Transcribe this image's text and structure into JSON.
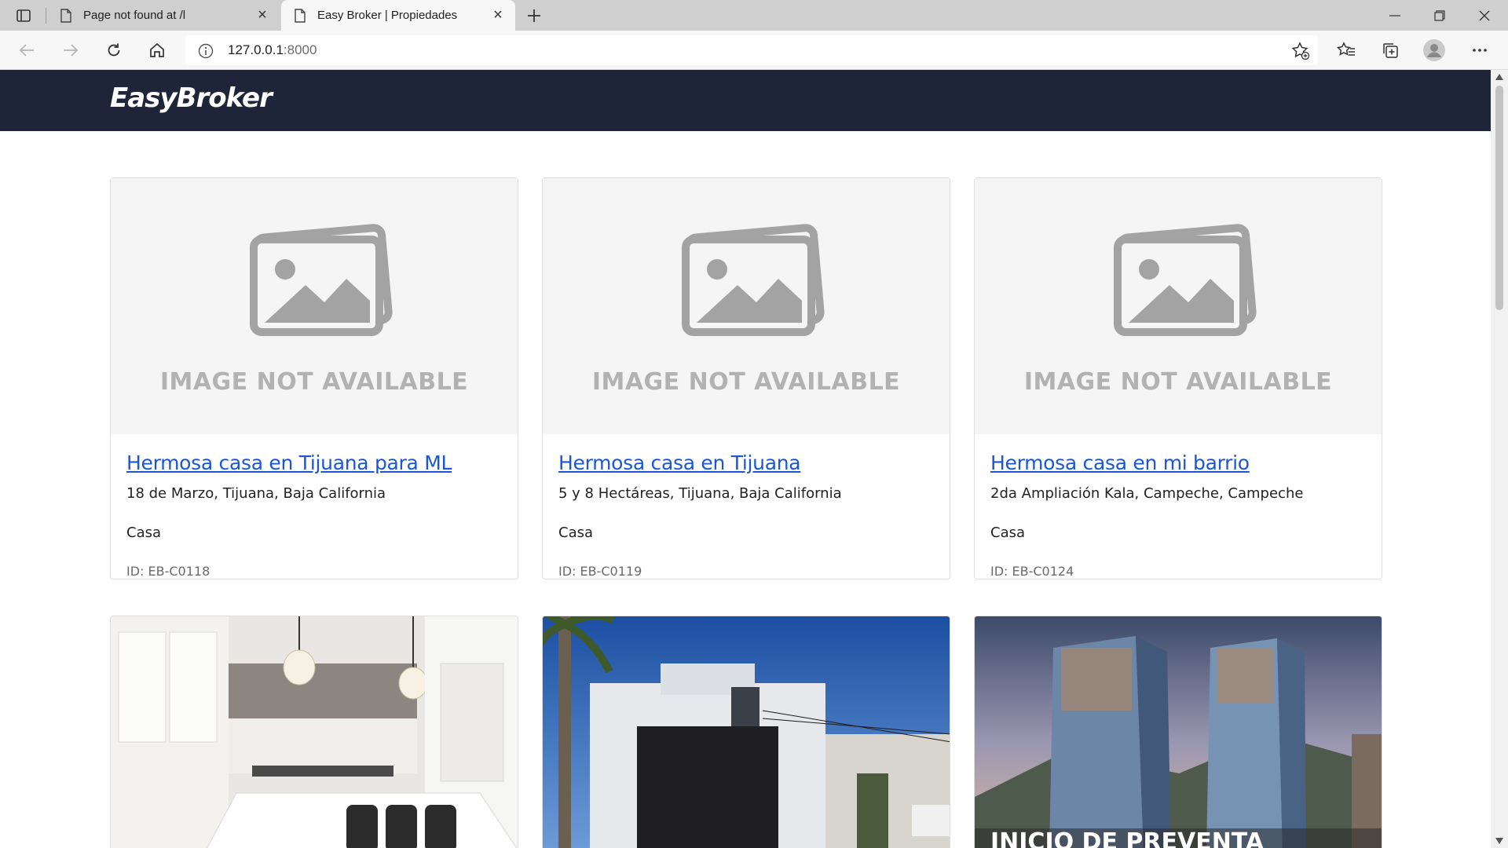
{
  "browser": {
    "tabs": [
      {
        "title": "Page not found at /l",
        "active": false
      },
      {
        "title": "Easy Broker | Propiedades",
        "active": true
      }
    ],
    "address": {
      "host": "127.0.0.1",
      "port": ":8000"
    }
  },
  "site": {
    "logo": "EasyBroker",
    "header_color": "#1e2538",
    "link_color": "#1a56db"
  },
  "properties": [
    {
      "title": "Hermosa casa en Tijuana para ML",
      "location": "18 de Marzo, Tijuana, Baja California",
      "type": "Casa",
      "id_label": "ID: EB-C0118",
      "image_caption": "IMAGE NOT AVAILABLE"
    },
    {
      "title": "Hermosa casa en Tijuana",
      "location": "5 y 8 Hectáreas, Tijuana, Baja California",
      "type": "Casa",
      "id_label": "ID: EB-C0119",
      "image_caption": "IMAGE NOT AVAILABLE"
    },
    {
      "title": "Hermosa casa en mi barrio",
      "location": "2da Ampliación Kala, Campeche, Campeche",
      "type": "Casa",
      "id_label": "ID: EB-C0124",
      "image_caption": "IMAGE NOT AVAILABLE"
    }
  ],
  "photo_cards": [
    {
      "subject": "kitchen-photo"
    },
    {
      "subject": "house-facade-photo"
    },
    {
      "subject": "towers-render-photo",
      "overlay_text": "INICIO DE PREVENTA"
    }
  ]
}
